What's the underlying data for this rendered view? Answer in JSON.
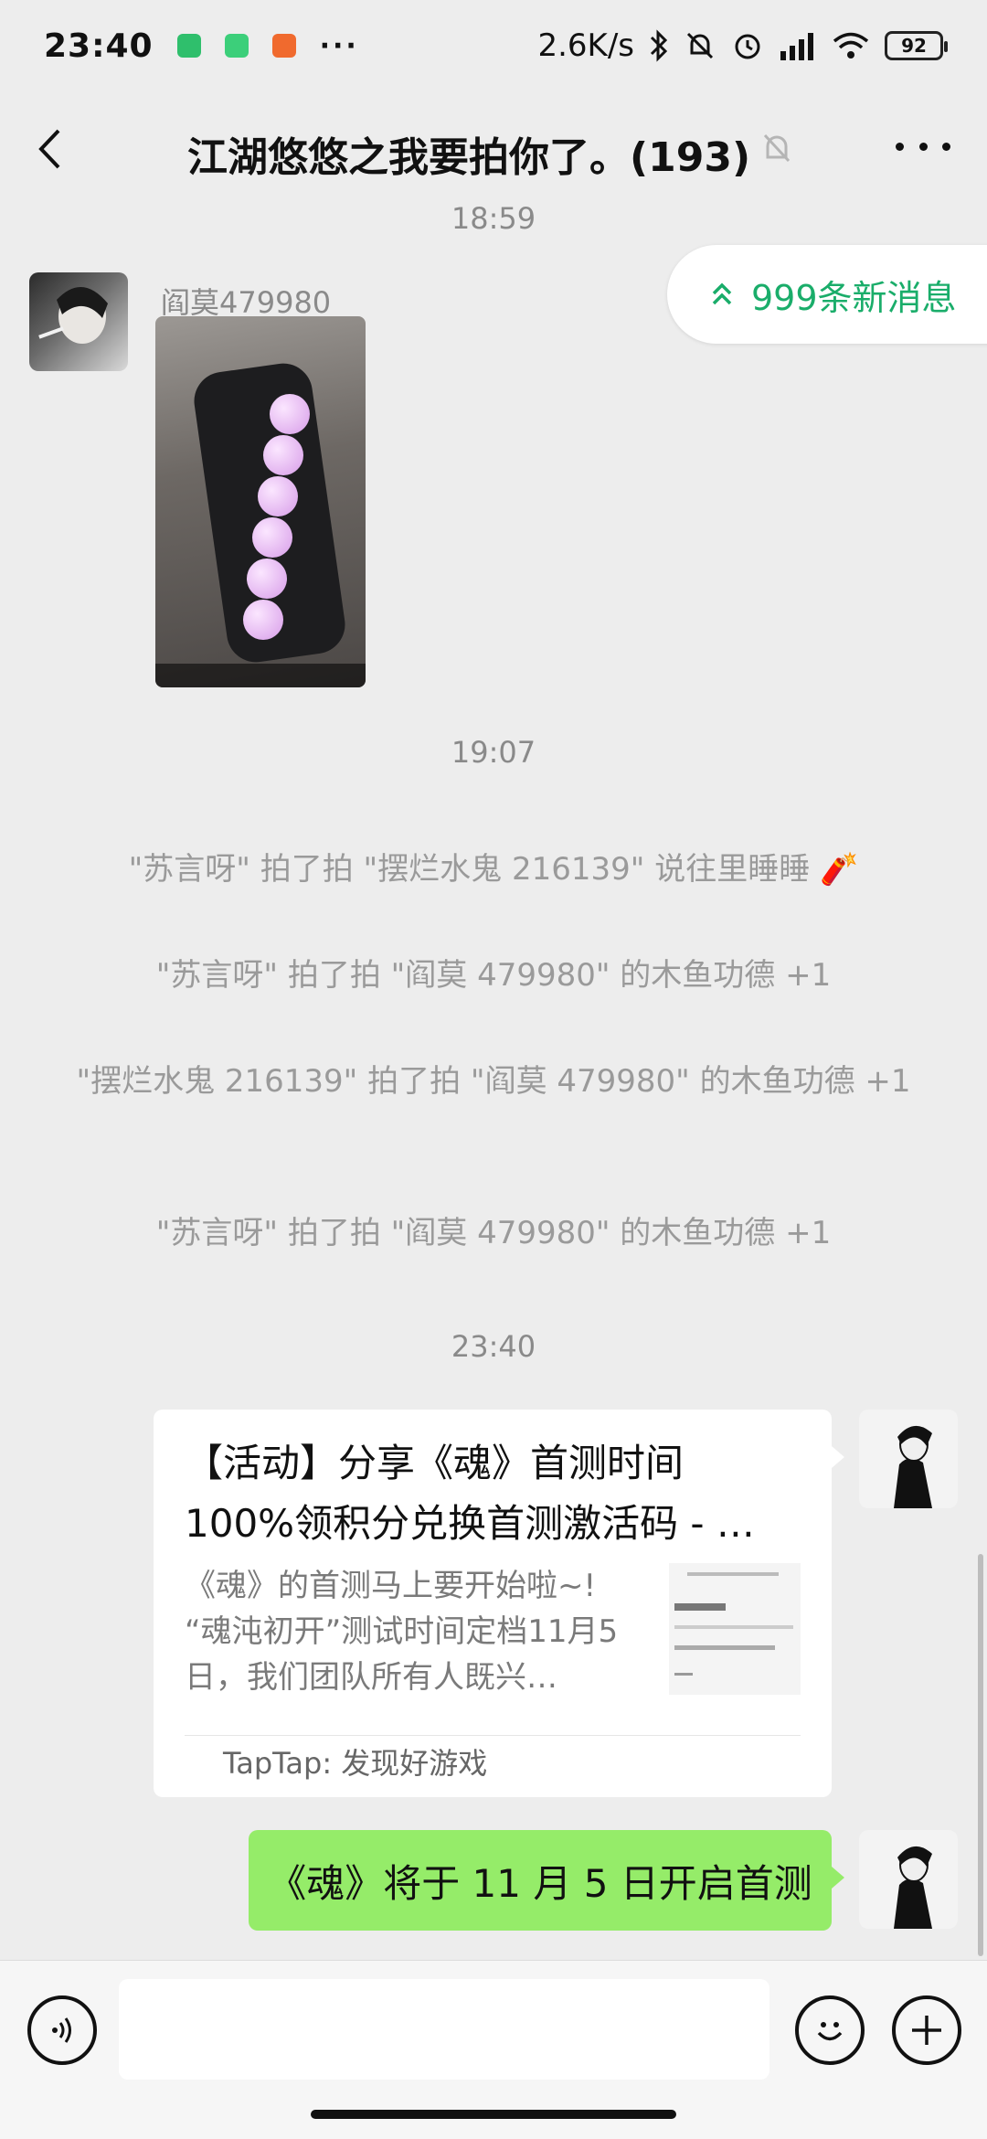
{
  "status_bar": {
    "time": "23:40",
    "dots": "···",
    "net_speed": "2.6K/s",
    "battery": "92"
  },
  "header": {
    "title": "江湖悠悠之我要拍你了。(193)"
  },
  "chat": {
    "timestamps": [
      "18:59",
      "19:07",
      "23:40"
    ],
    "sender_name": "阎莫479980",
    "new_messages": "999条新消息",
    "system_messages": [
      "\"苏言呀\" 拍了拍 \"摆烂水鬼 216139\" 说往里睡睡 🧨",
      "\"苏言呀\" 拍了拍 \"阎莫 479980\" 的木鱼功德 +1",
      "\"摆烂水鬼 216139\" 拍了拍 \"阎莫 479980\" 的木鱼功德 +1",
      "\"苏言呀\" 拍了拍 \"阎莫 479980\" 的木鱼功德 +1"
    ],
    "card": {
      "title": "【活动】分享《魂》首测时间 100%领积分兑换首测激活码 - …",
      "desc": "《魂》的首测马上要开始啦~! “魂沌初开”测试时间定档11月5日，我们团队所有人既兴…",
      "source": "TapTap: 发现好游戏"
    },
    "text_message": "《魂》将于 11 月 5 日开启首测"
  },
  "input_bar": {
    "placeholder": ""
  }
}
